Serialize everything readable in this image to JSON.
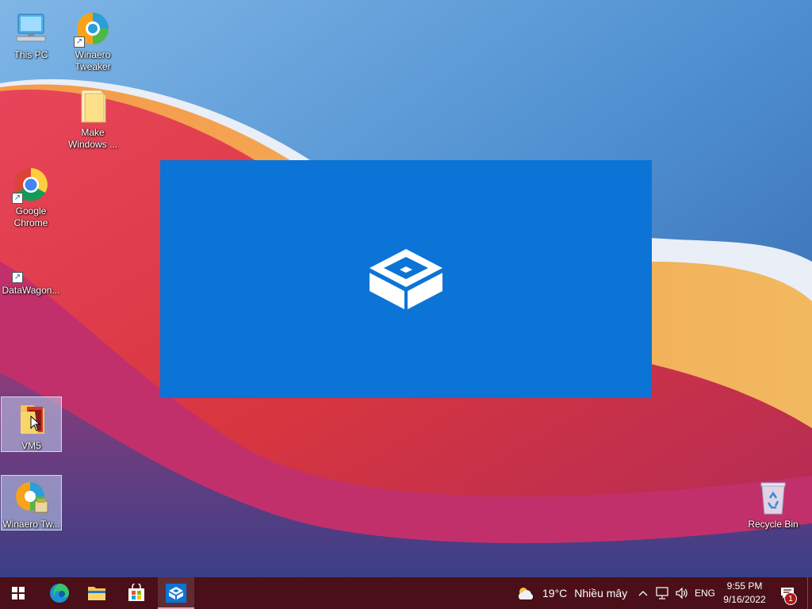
{
  "desktop": {
    "icons": [
      {
        "label": "This PC",
        "icon": "computer-icon",
        "shortcut": false
      },
      {
        "label": "Winaero Tweaker",
        "icon": "winaero-icon",
        "shortcut": true
      },
      {
        "label": "Make Windows ...",
        "icon": "folder-icon",
        "shortcut": false
      },
      {
        "label": "Google Chrome",
        "icon": "chrome-icon",
        "shortcut": true
      },
      {
        "label": "DataWagon...",
        "icon": "datawagon-icon",
        "shortcut": true
      },
      {
        "label": "VM5",
        "icon": "folder-icon",
        "shortcut": false,
        "selected": true
      },
      {
        "label": "Winaero Tw...",
        "icon": "winaero-installer-icon",
        "shortcut": false,
        "selected": true
      },
      {
        "label": "Recycle Bin",
        "icon": "recycle-bin-icon",
        "shortcut": false
      }
    ]
  },
  "splash": {
    "app": "Windows Sandbox",
    "icon": "sandbox-box-icon",
    "background": "#0b74d6"
  },
  "taskbar": {
    "background": "#4a0f18",
    "pinned": [
      {
        "name": "start-button",
        "icon": "windows-logo-icon"
      },
      {
        "name": "edge-button",
        "icon": "edge-icon"
      },
      {
        "name": "file-explorer-button",
        "icon": "folder-icon"
      },
      {
        "name": "store-button",
        "icon": "store-icon"
      },
      {
        "name": "sandbox-button",
        "icon": "sandbox-icon",
        "active": true
      }
    ],
    "weather": {
      "temp": "19°C",
      "condition": "Nhiều mây",
      "icon": "partly-cloudy-icon"
    },
    "tray": {
      "language": "ENG"
    },
    "clock": {
      "time": "9:55 PM",
      "date": "9/16/2022"
    },
    "notifications": {
      "count": "1"
    }
  }
}
